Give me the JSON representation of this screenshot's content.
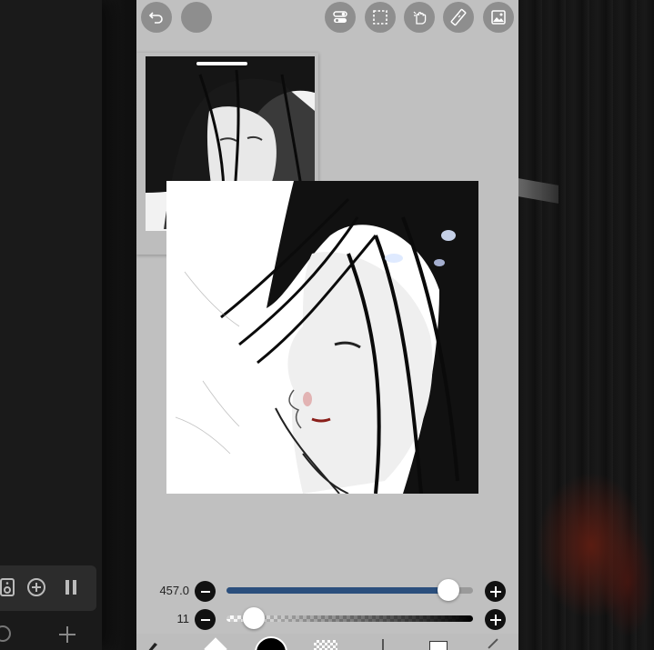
{
  "toolbar": {
    "undo_icon": "undo-icon",
    "redo_icon": "redo-icon",
    "tools": [
      "toggle-icon",
      "selection-icon",
      "hand-icon",
      "ruler-icon",
      "image-icon"
    ]
  },
  "navigator": {
    "visible": true
  },
  "sliders": {
    "brush_size": {
      "value": "457.0",
      "fraction": 0.9,
      "color": "#2b4f7d"
    },
    "opacity": {
      "value": "11",
      "fraction": 0.11
    }
  },
  "left_panel": {
    "icons": [
      "speaker-icon",
      "add-circle-icon",
      "pause-icon"
    ],
    "bottom_icon": "plus-icon"
  },
  "colors": {
    "app_bg": "#c0c0c0",
    "button_bg": "#8e8e8e",
    "accent": "#2b4f7d"
  }
}
